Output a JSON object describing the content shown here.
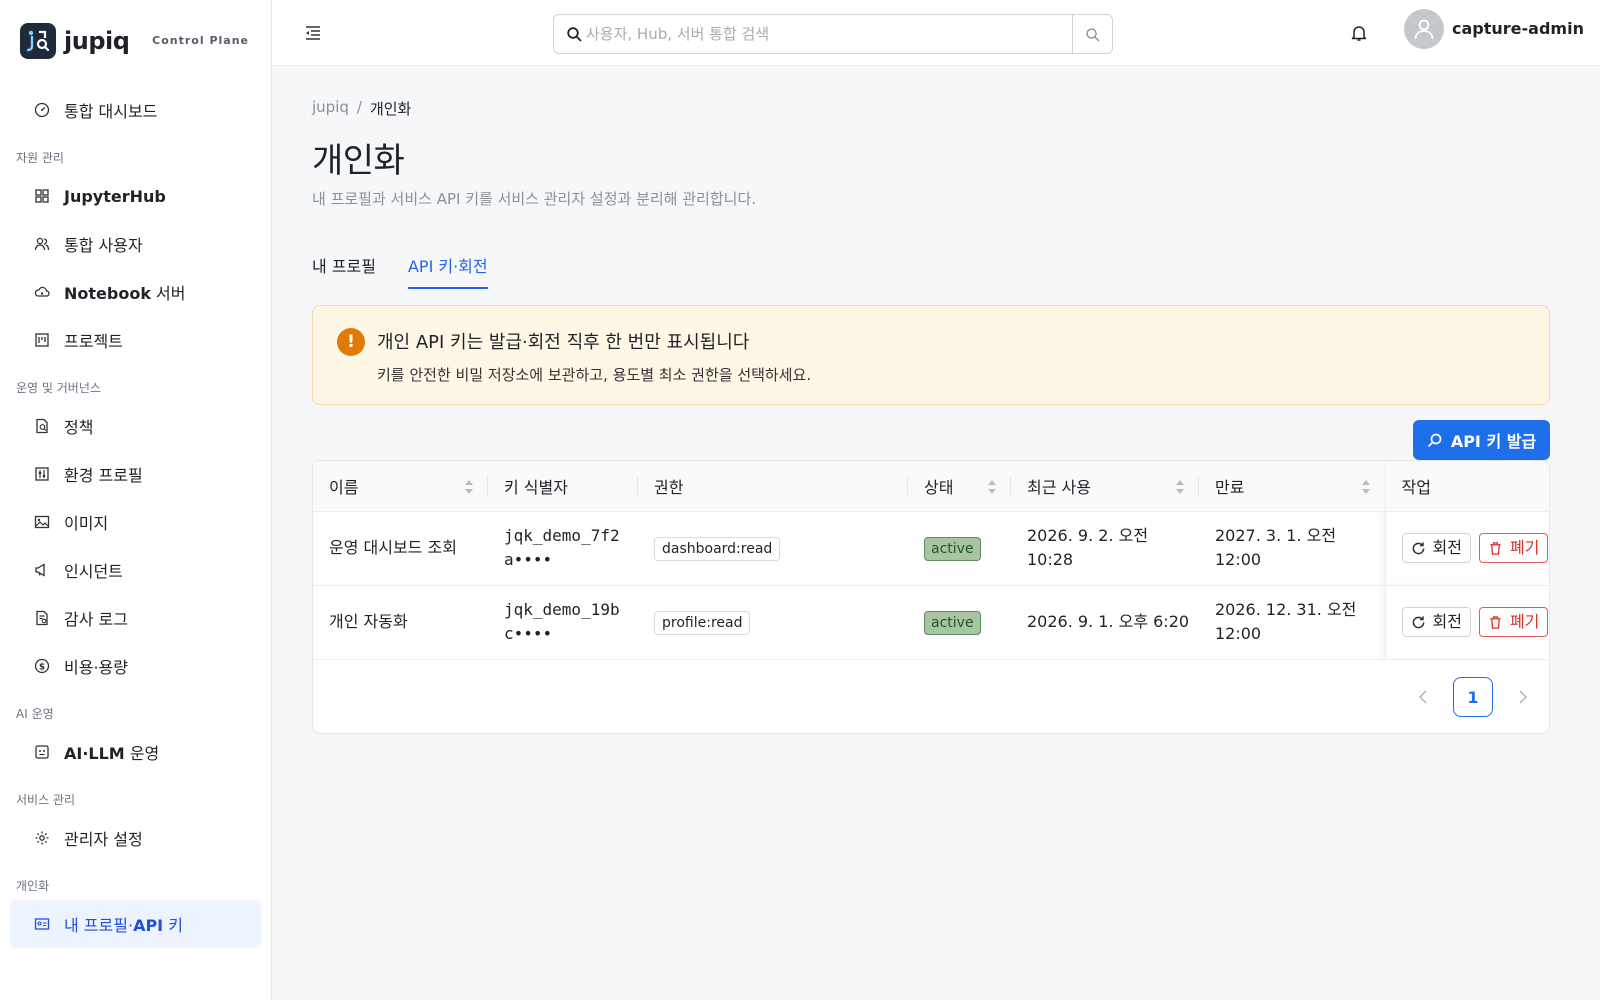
{
  "brand": {
    "name": "jupiq",
    "subtitle": "Control Plane"
  },
  "sidebar": {
    "dashboard": "통합 대시보드",
    "sections": {
      "resources": "자원 관리",
      "ops": "운영 및 거버넌스",
      "ai": "AI 운영",
      "service": "서비스 관리",
      "personal": "개인화"
    },
    "jupyterhub": "JupyterHub",
    "users": "통합 사용자",
    "notebook_bold": "Notebook",
    "notebook_rest": " 서버",
    "projects": "프로젝트",
    "policy": "정책",
    "env_profile": "환경 프로필",
    "images": "이미지",
    "incidents": "인시던트",
    "audit": "감사 로그",
    "cost": "비용·용량",
    "ai_llm_bold": "AI·LLM",
    "ai_llm_rest": " 운영",
    "admin_settings": "관리자 설정",
    "my_profile_pre": "내 프로필·",
    "my_profile_bold": "API",
    "my_profile_post": " 키"
  },
  "header": {
    "search_placeholder": "사용자, Hub, 서버 통합 검색",
    "user": "capture-admin"
  },
  "page": {
    "breadcrumb_root": "jupiq",
    "breadcrumb_sep": "/",
    "breadcrumb_current": "개인화",
    "title": "개인화",
    "description": "내 프로필과 서비스 API 키를 서비스 관리자 설정과 분리해 관리합니다."
  },
  "tabs": {
    "profile": "내 프로필",
    "api": "API 키·회전"
  },
  "alert": {
    "icon": "!",
    "title": "개인 API 키는 발급·회전 직후 한 번만 표시됩니다",
    "detail": "키를 안전한 비밀 저장소에 보관하고, 용도별 최소 권한을 선택하세요."
  },
  "issue_button": "API 키 발급",
  "table": {
    "columns": [
      "이름",
      "키 식별자",
      "권한",
      "상태",
      "최근 사용",
      "만료",
      "작업"
    ],
    "rows": [
      {
        "name": "운영 대시보드 조회",
        "key1": "jqk_demo_7f2",
        "key2": "a••••",
        "perm": "dashboard:read",
        "status": "active",
        "last1": "2026. 9. 2. 오전",
        "last2": "10:28",
        "exp1": "2027. 3. 1. 오전",
        "exp2": "12:00"
      },
      {
        "name": "개인 자동화",
        "key1": "jqk_demo_19b",
        "key2": "c••••",
        "perm": "profile:read",
        "status": "active",
        "last1": "2026. 9. 1. 오후 6:20",
        "last2": "",
        "exp1": "2026. 12. 31. 오전",
        "exp2": "12:00"
      }
    ],
    "rotate": "회전",
    "revoke": "폐기"
  },
  "pager": {
    "current": "1"
  }
}
